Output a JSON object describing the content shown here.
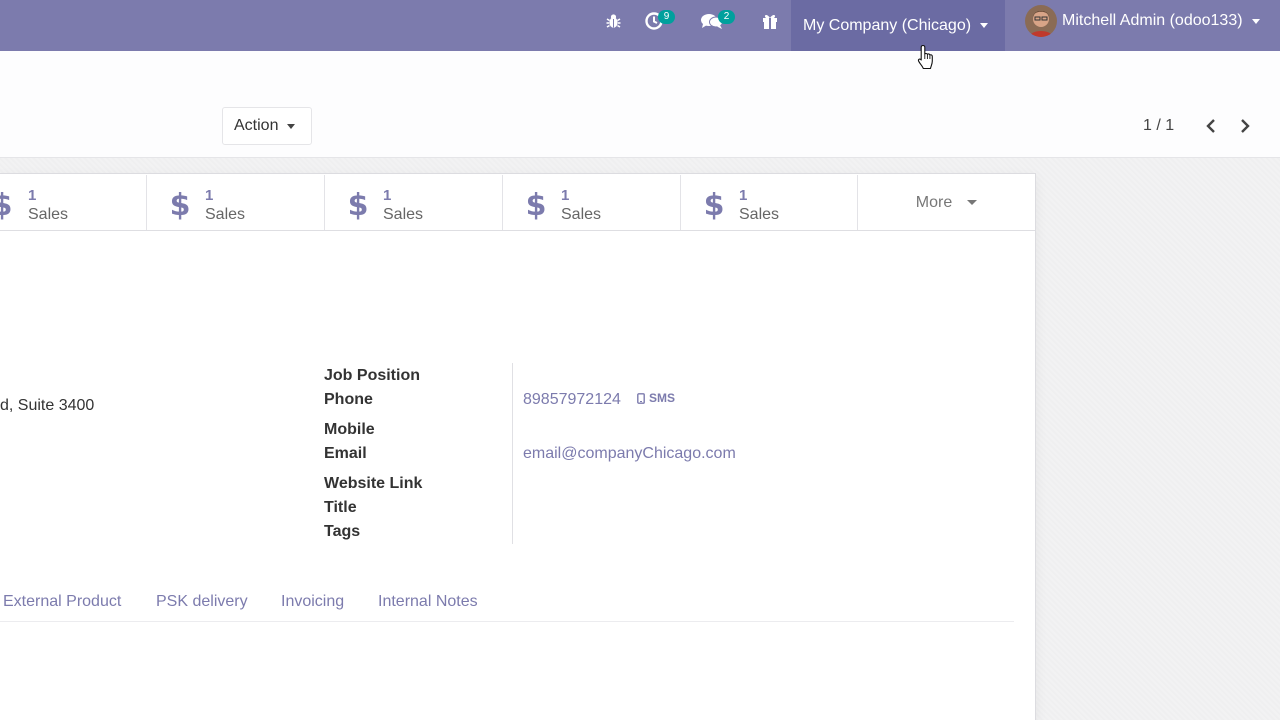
{
  "navbar": {
    "activity_count": "9",
    "messages_count": "2",
    "company_label": "My Company (Chicago)",
    "user_label": "Mitchell Admin (odoo133)",
    "icons": [
      "bug-icon",
      "clock-icon",
      "comments-icon",
      "gift-icon"
    ],
    "colors": {
      "background": "#7c7bad",
      "company_bg": "#6b6ba3",
      "badge": "#00a09d"
    }
  },
  "control_panel": {
    "action_label": "Action",
    "pager": "1 / 1"
  },
  "stat_buttons": [
    {
      "value": "1",
      "label": "Sales",
      "icon": "dollar-icon"
    },
    {
      "value": "1",
      "label": "Sales",
      "icon": "dollar-icon"
    },
    {
      "value": "1",
      "label": "Sales",
      "icon": "dollar-icon"
    },
    {
      "value": "1",
      "label": "Sales",
      "icon": "dollar-icon"
    },
    {
      "value": "1",
      "label": "Sales",
      "icon": "dollar-icon"
    }
  ],
  "more_label": "More",
  "address": {
    "street_partial": "d, Suite 3400"
  },
  "fields": {
    "job_position_label": "Job Position",
    "phone_label": "Phone",
    "phone_value": "89857972124",
    "sms_label": "SMS",
    "mobile_label": "Mobile",
    "email_label": "Email",
    "email_value": "email@companyChicago.com",
    "website_label": "Website Link",
    "title_label": "Title",
    "tags_label": "Tags"
  },
  "tabs": [
    "External Product",
    "PSK delivery",
    "Invoicing",
    "Internal Notes"
  ]
}
